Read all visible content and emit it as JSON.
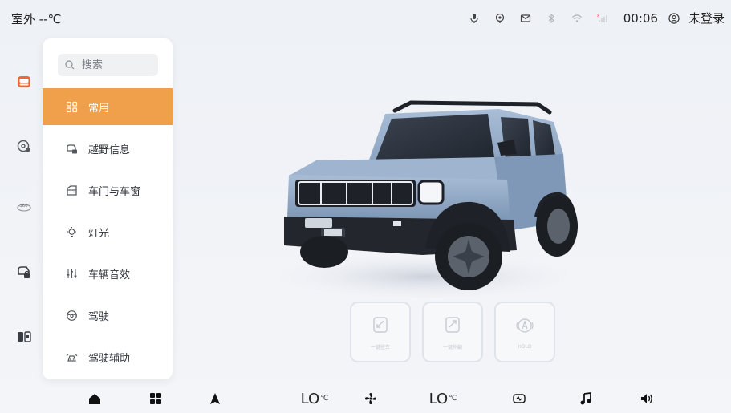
{
  "status_bar": {
    "outside_temp": "室外 --℃",
    "clock": "00:06",
    "login_label": "未登录",
    "icons": [
      "mic-icon",
      "location-icon",
      "message-icon",
      "bluetooth-icon",
      "wifi-icon",
      "cellular-signal-icon",
      "user-icon"
    ]
  },
  "rail": {
    "items": [
      "vehicle-settings-icon",
      "offroad-icon",
      "camera-360-icon",
      "door-lock-icon",
      "split-screen-icon"
    ],
    "camera_label": "360"
  },
  "menu": {
    "search_placeholder": "搜索",
    "items": [
      {
        "label": "常用",
        "icon": "grid-icon",
        "active": true
      },
      {
        "label": "越野信息",
        "icon": "offroad-info-icon",
        "active": false
      },
      {
        "label": "车门与车窗",
        "icon": "door-window-icon",
        "active": false
      },
      {
        "label": "灯光",
        "icon": "light-icon",
        "active": false
      },
      {
        "label": "车辆音效",
        "icon": "equalizer-icon",
        "active": false
      },
      {
        "label": "驾驶",
        "icon": "steering-wheel-icon",
        "active": false
      },
      {
        "label": "驾驶辅助",
        "icon": "driving-assist-icon",
        "active": false
      }
    ]
  },
  "quick_actions": [
    {
      "label": "一键驻车",
      "icon": "one-key-park-icon"
    },
    {
      "label": "一键外翻",
      "icon": "one-key-fold-icon"
    },
    {
      "label": "HOLD",
      "icon": "auto-hold-icon"
    }
  ],
  "dock": {
    "driver_temp": "LO",
    "passenger_temp": "LO",
    "temp_unit": "℃",
    "icons": [
      "home-icon",
      "apps-icon",
      "navigation-icon",
      "fan-icon",
      "seat-icon",
      "music-icon",
      "volume-icon"
    ]
  },
  "colors": {
    "accent": "#f0a04b",
    "panel_bg": "#ffffff",
    "page_bg": "#eef1f6",
    "car_body": "#8ea7c4"
  }
}
